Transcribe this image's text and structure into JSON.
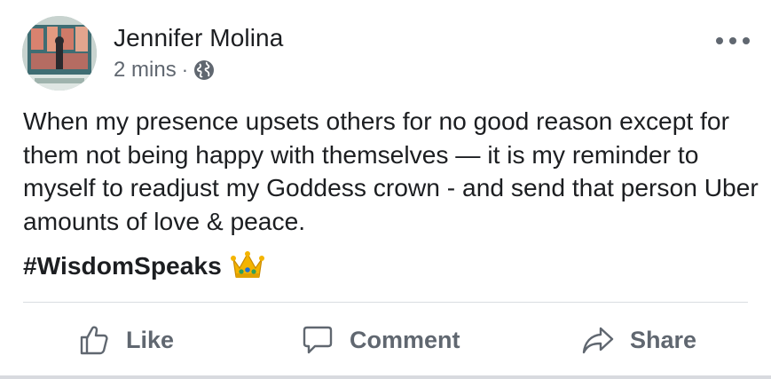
{
  "post": {
    "author": "Jennifer Molina",
    "timestamp": "2 mins",
    "separator": "·",
    "privacy_icon": "globe-icon",
    "body": "When my presence upsets others for no good reason except for them not being happy with themselves — it is my reminder to myself to readjust my Goddess crown - and send that person Uber amounts of love & peace.",
    "hashtag": "#WisdomSpeaks",
    "hashtag_emoji": "crown-emoji"
  },
  "actions": {
    "like_label": "Like",
    "comment_label": "Comment",
    "share_label": "Share"
  },
  "colors": {
    "text_primary": "#1c1e21",
    "text_secondary": "#606770",
    "divider": "#dadde1"
  }
}
